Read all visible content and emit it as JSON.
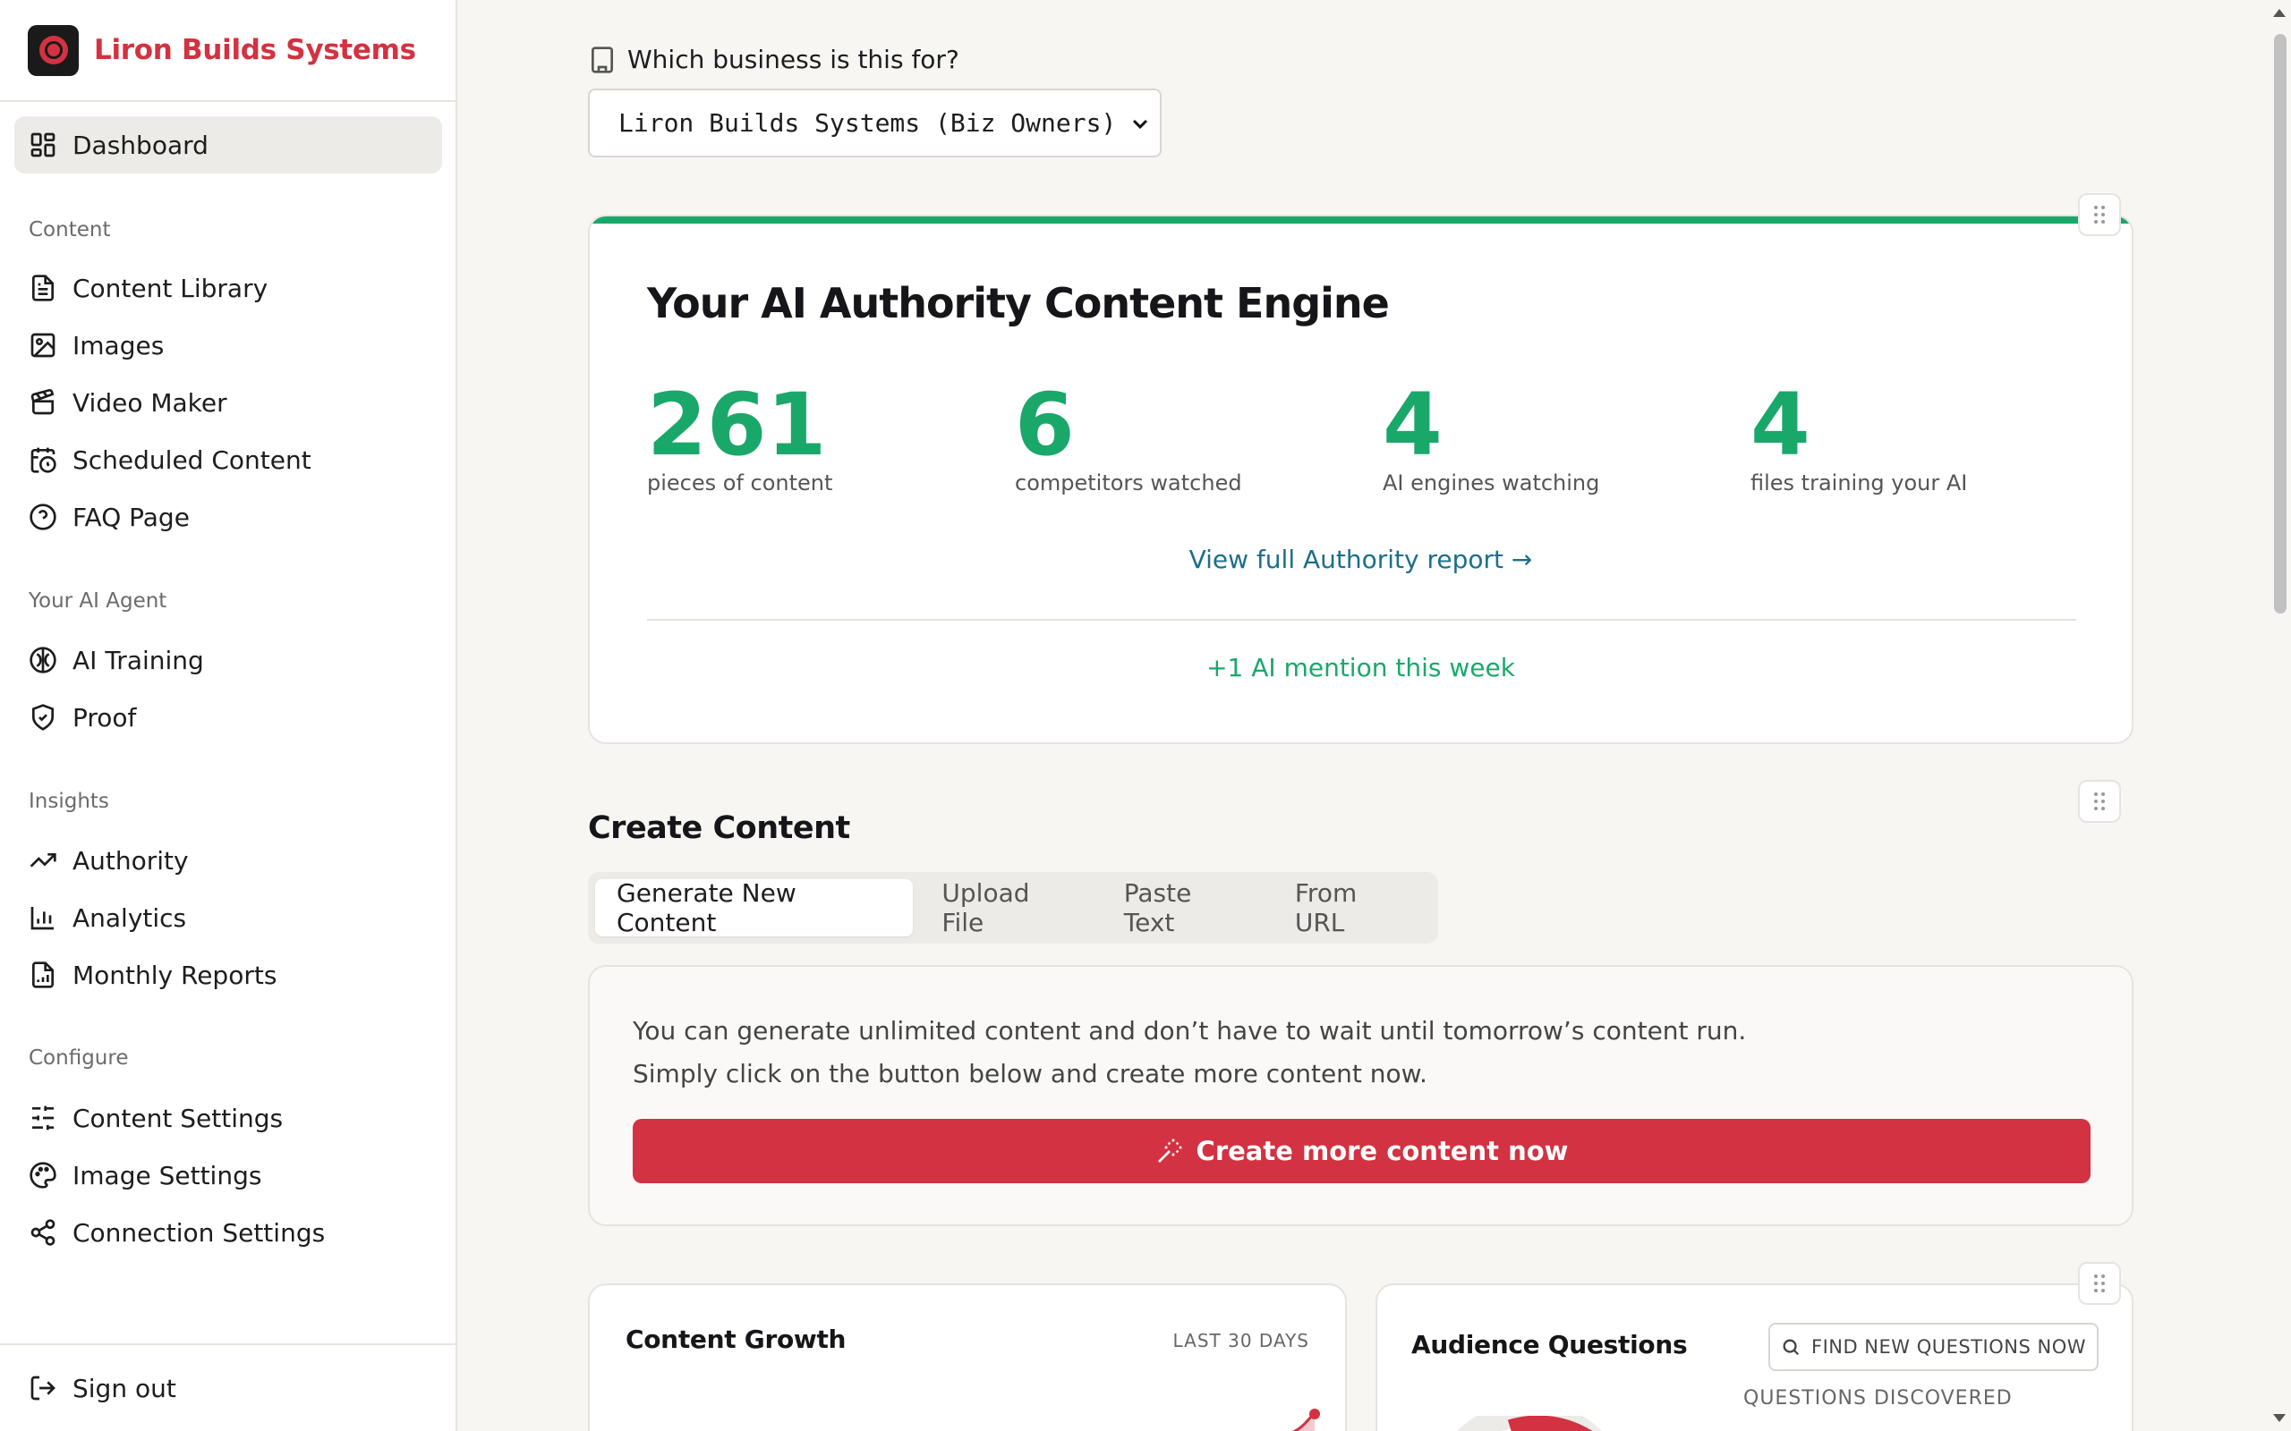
{
  "brand": {
    "name": "Liron Builds Systems"
  },
  "sidebar": {
    "dashboard": "Dashboard",
    "sections": {
      "content": "Content",
      "agent": "Your AI Agent",
      "insights": "Insights",
      "configure": "Configure"
    },
    "items": {
      "content_library": "Content Library",
      "images": "Images",
      "video_maker": "Video Maker",
      "scheduled_content": "Scheduled Content",
      "faq_page": "FAQ Page",
      "ai_training": "AI Training",
      "proof": "Proof",
      "authority": "Authority",
      "analytics": "Analytics",
      "monthly_reports": "Monthly Reports",
      "content_settings": "Content Settings",
      "image_settings": "Image Settings",
      "connection_settings": "Connection Settings"
    },
    "sign_out": "Sign out"
  },
  "business": {
    "label": "Which business is this for?",
    "selected": "Liron Builds Systems (Biz Owners)"
  },
  "authority": {
    "title": "Your AI Authority Content Engine",
    "stats": [
      {
        "value": "261",
        "label": "pieces of content"
      },
      {
        "value": "6",
        "label": "competitors watched"
      },
      {
        "value": "4",
        "label": "AI engines watching"
      },
      {
        "value": "4",
        "label": "files training your AI"
      }
    ],
    "report_link": "View full Authority report →",
    "mention": "+1 AI mention this week"
  },
  "create": {
    "title": "Create Content",
    "tabs": [
      "Generate New Content",
      "Upload File",
      "Paste Text",
      "From URL"
    ],
    "line1": "You can generate unlimited content and don’t have to wait until tomorrow’s content run.",
    "line2": "Simply click on the button below and create more content now.",
    "button": "Create more content now"
  },
  "growth": {
    "title": "Content Growth",
    "range": "LAST 30 DAYS"
  },
  "questions": {
    "title": "Audience Questions",
    "find_button": "FIND NEW QUESTIONS NOW",
    "discovered_label": "QUESTIONS DISCOVERED"
  },
  "colors": {
    "brand_red": "#d23241",
    "accent_green": "#1aa86a",
    "link_blue": "#1a6f8c"
  }
}
